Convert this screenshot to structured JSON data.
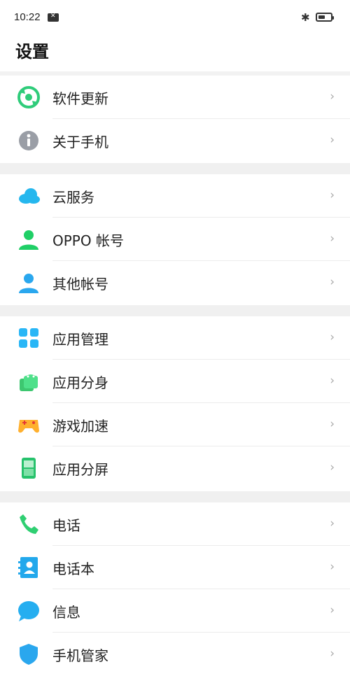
{
  "status_bar": {
    "time": "10:22"
  },
  "header": {
    "title": "设置"
  },
  "groups": [
    {
      "items": [
        {
          "label": "软件更新",
          "icon": "software-update-icon"
        },
        {
          "label": "关于手机",
          "icon": "info-icon"
        }
      ]
    },
    {
      "items": [
        {
          "label": "云服务",
          "icon": "cloud-icon"
        },
        {
          "label": "OPPO 帐号",
          "icon": "account-icon"
        },
        {
          "label": "其他帐号",
          "icon": "other-accounts-icon"
        }
      ]
    },
    {
      "items": [
        {
          "label": "应用管理",
          "icon": "app-management-icon"
        },
        {
          "label": "应用分身",
          "icon": "app-clone-icon"
        },
        {
          "label": "游戏加速",
          "icon": "game-accelerate-icon"
        },
        {
          "label": "应用分屏",
          "icon": "split-screen-icon"
        }
      ]
    },
    {
      "items": [
        {
          "label": "电话",
          "icon": "phone-icon"
        },
        {
          "label": "电话本",
          "icon": "contacts-icon"
        },
        {
          "label": "信息",
          "icon": "messages-icon"
        },
        {
          "label": "手机管家",
          "icon": "phone-manager-icon"
        }
      ]
    }
  ],
  "chevron": "›"
}
